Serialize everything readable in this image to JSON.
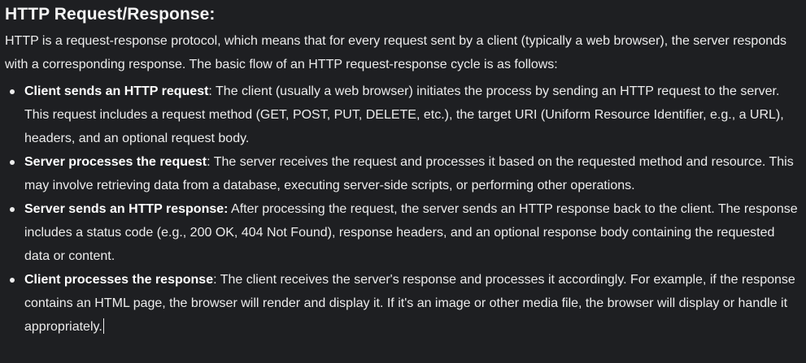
{
  "heading": "HTTP Request/Response:",
  "intro": "HTTP is a request-response protocol, which means that for every request sent by a client (typically a web browser), the server responds with a corresponding response. The basic flow of an HTTP request-response cycle is as follows:",
  "items": [
    {
      "term": "Client sends an HTTP request",
      "text": ": The client (usually a web browser) initiates the process by sending an HTTP request to the server. This request includes a request method (GET, POST, PUT, DELETE, etc.), the target URI (Uniform Resource Identifier, e.g., a URL), headers, and an optional request body."
    },
    {
      "term": "Server processes the request",
      "text": ": The server receives the request and processes it based on the requested method and resource. This may involve retrieving data from a database, executing server-side scripts, or performing other operations."
    },
    {
      "term": "Server sends an HTTP response:",
      "text": " After processing the request, the server sends an HTTP response back to the client. The response includes a status code (e.g., 200 OK, 404 Not Found), response headers, and an optional response body containing the requested data or content."
    },
    {
      "term": "Client processes the response",
      "text": ": The client receives the server's response and processes it accordingly. For example, if the response contains an HTML page, the browser will render and display it. If it's an image or other media file, the browser will display or handle it appropriately."
    }
  ]
}
